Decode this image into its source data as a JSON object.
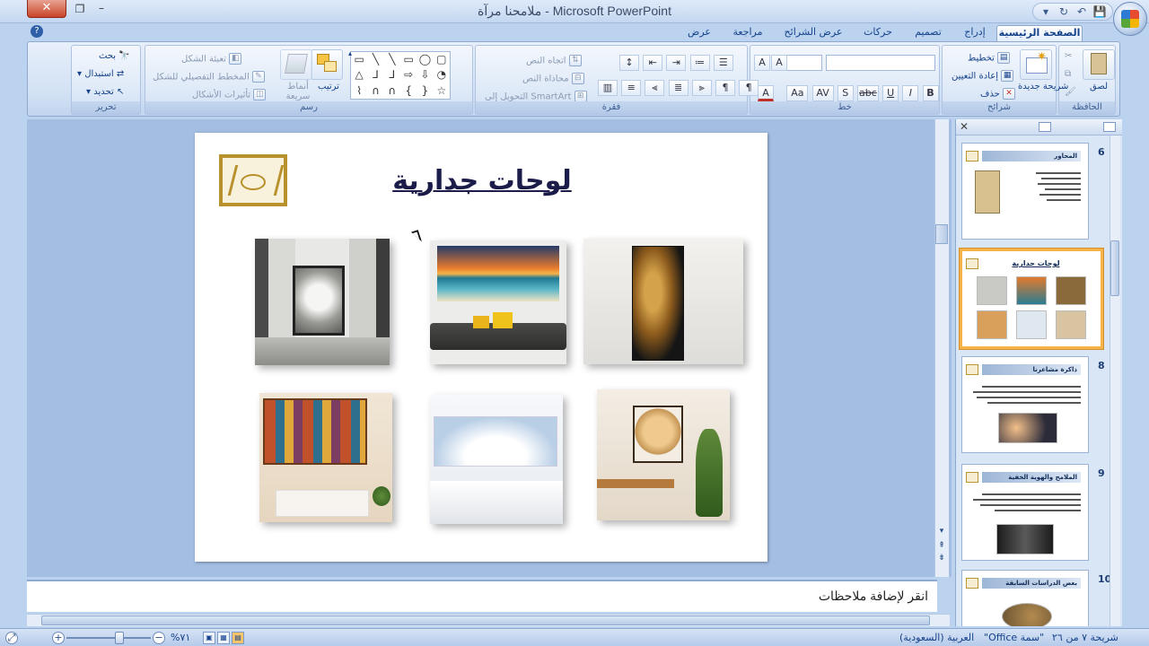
{
  "window": {
    "title": "ملامحنا مرآة - Microsoft PowerPoint",
    "close_glyph": "✕",
    "restore_glyph": "❐",
    "minimize_glyph": "–"
  },
  "quick_access": [
    {
      "name": "save-icon",
      "glyph": "💾"
    },
    {
      "name": "undo-icon",
      "glyph": "↶"
    },
    {
      "name": "redo-icon",
      "glyph": "↻"
    },
    {
      "name": "customize-icon",
      "glyph": "▾"
    }
  ],
  "tabs": [
    {
      "label": "الصفحة الرئيسية",
      "active": true
    },
    {
      "label": "إدراج"
    },
    {
      "label": "تصميم"
    },
    {
      "label": "حركات"
    },
    {
      "label": "عرض الشرائح"
    },
    {
      "label": "مراجعة"
    },
    {
      "label": "عرض"
    }
  ],
  "help_glyph": "?",
  "ribbon": {
    "clipboard": {
      "label": "الحافظة",
      "paste": "لصق"
    },
    "slides": {
      "label": "شرائح",
      "new_slide": "شريحة جديدة",
      "layout": "تخطيط",
      "reset": "إعادة التعيين",
      "delete": "حذف"
    },
    "font": {
      "label": "خط",
      "bold": "B",
      "italic": "I",
      "underline": "U",
      "strike": "abc",
      "shadow": "S",
      "spacing": "AV",
      "case": "Aa",
      "color": "A",
      "grow": "A",
      "shrink": "A"
    },
    "paragraph": {
      "label": "فقرة",
      "text_direction": "اتجاه النص",
      "align_text": "محاذاة النص",
      "convert_smartart": "التحويل إلى SmartArt"
    },
    "drawing": {
      "label": "رسم",
      "arrange": "ترتيب",
      "quick_styles": "أنماط سريعة",
      "shape_fill": "تعبئة الشكل",
      "shape_outline": "المخطط التفصيلي للشكل",
      "shape_effects": "تأثيرات الأشكال"
    },
    "editing": {
      "label": "تحرير",
      "find": "بحث",
      "replace": "استبدال",
      "select": "تحديد"
    }
  },
  "slide": {
    "title": "لوحات جدارية"
  },
  "thumbnails": [
    {
      "number": "6",
      "title": "المحاور"
    },
    {
      "number": "7",
      "title": "لوحات جدارية",
      "selected": true
    },
    {
      "number": "8",
      "title": "ذاكرة مشاعرنا"
    },
    {
      "number": "9",
      "title": "الملامح والهوية الخفية"
    },
    {
      "number": "10",
      "title": "بعض الدراسات السابقة"
    }
  ],
  "notes": {
    "placeholder": "انقر لإضافة ملاحظات"
  },
  "status": {
    "slide_position": "شريحة ٧ من ٢٦",
    "theme": "\"سمة Office\"",
    "language": "العربية (السعودية)",
    "zoom": "%٧١"
  }
}
